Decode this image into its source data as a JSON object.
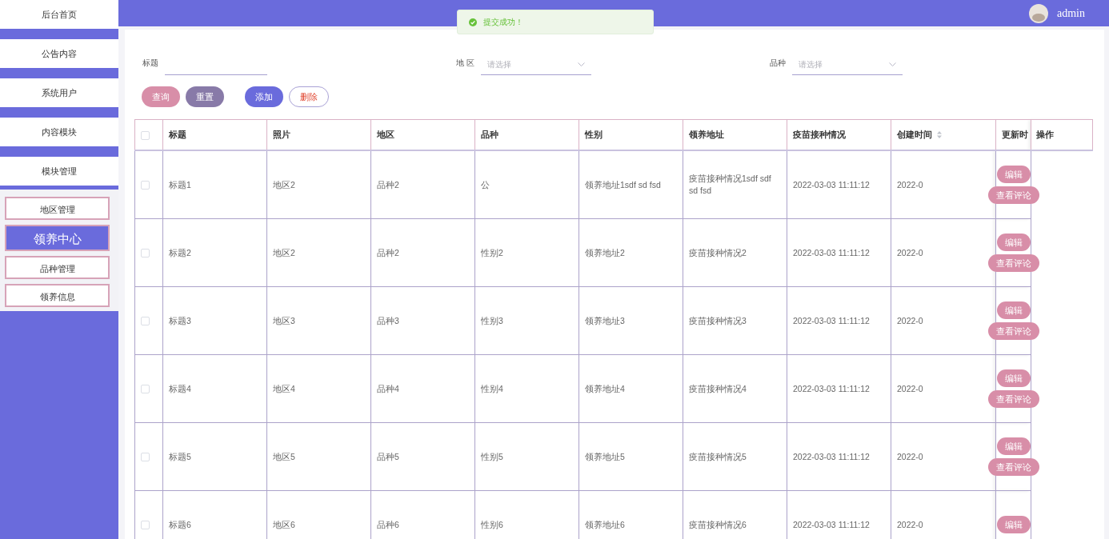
{
  "sidebar": {
    "items": [
      {
        "label": "后台首页",
        "kind": "main",
        "selected": false
      },
      {
        "label": "公告内容",
        "kind": "main",
        "selected": false
      },
      {
        "label": "系统用户",
        "kind": "main",
        "selected": false
      },
      {
        "label": "内容模块",
        "kind": "main",
        "selected": false
      },
      {
        "label": "模块管理",
        "kind": "main",
        "selected": false
      },
      {
        "label": "地区管理",
        "kind": "sub",
        "selected": false
      },
      {
        "label": "领养中心",
        "kind": "sub",
        "selected": true
      },
      {
        "label": "品种管理",
        "kind": "sub",
        "selected": false
      },
      {
        "label": "领养信息",
        "kind": "sub",
        "selected": false
      }
    ]
  },
  "header": {
    "user": "admin"
  },
  "toast": {
    "text": "提交成功！"
  },
  "filters": [
    {
      "label": "标题",
      "kind": "input"
    },
    {
      "label": "地 区",
      "kind": "select",
      "placeholder": "请选择"
    },
    {
      "label": "品种",
      "kind": "select",
      "placeholder": "请选择"
    }
  ],
  "buttons": [
    {
      "label": "查询",
      "kind": "query"
    },
    {
      "label": "重置",
      "kind": "reset"
    },
    {
      "label": "添加",
      "kind": "add"
    },
    {
      "label": "删除",
      "kind": "delete"
    }
  ],
  "table": {
    "select_all": {
      "checked": false
    },
    "columns": [
      {
        "label": "标题"
      },
      {
        "label": "照片"
      },
      {
        "label": "地区"
      },
      {
        "label": "品种"
      },
      {
        "label": "性别"
      },
      {
        "label": "领养地址"
      },
      {
        "label": "疫苗接种情况"
      },
      {
        "label": "创建时间",
        "sortable": true
      },
      {
        "label": "更新时"
      },
      {
        "label": "操作"
      }
    ],
    "rows": [
      {
        "checked": false,
        "cells": [
          "标题1",
          "地区2",
          "品种2",
          "公",
          "领养地址1sdf sd fsd",
          "疫苗接种情况1sdf sdf sd fsd",
          "2022-03-03 11:11:12",
          "2022-0"
        ],
        "actions": [
          "编辑",
          "查看评论"
        ]
      },
      {
        "checked": false,
        "cells": [
          "标题2",
          "地区2",
          "品种2",
          "性别2",
          "领养地址2",
          "疫苗接种情况2",
          "2022-03-03 11:11:12",
          "2022-0"
        ],
        "actions": [
          "编辑",
          "查看评论"
        ]
      },
      {
        "checked": false,
        "cells": [
          "标题3",
          "地区3",
          "品种3",
          "性别3",
          "领养地址3",
          "疫苗接种情况3",
          "2022-03-03 11:11:12",
          "2022-0"
        ],
        "actions": [
          "编辑",
          "查看评论"
        ]
      },
      {
        "checked": false,
        "cells": [
          "标题4",
          "地区4",
          "品种4",
          "性别4",
          "领养地址4",
          "疫苗接种情况4",
          "2022-03-03 11:11:12",
          "2022-0"
        ],
        "actions": [
          "编辑",
          "查看评论"
        ]
      },
      {
        "checked": false,
        "cells": [
          "标题5",
          "地区5",
          "品种5",
          "性别5",
          "领养地址5",
          "疫苗接种情况5",
          "2022-03-03 11:11:12",
          "2022-0"
        ],
        "actions": [
          "编辑",
          "查看评论"
        ]
      },
      {
        "checked": false,
        "cells": [
          "标题6",
          "地区6",
          "品种6",
          "性别6",
          "领养地址6",
          "疫苗接种情况6",
          "2022-03-03 11:11:12",
          "2022-0"
        ],
        "actions": [
          "编辑"
        ]
      }
    ]
  }
}
